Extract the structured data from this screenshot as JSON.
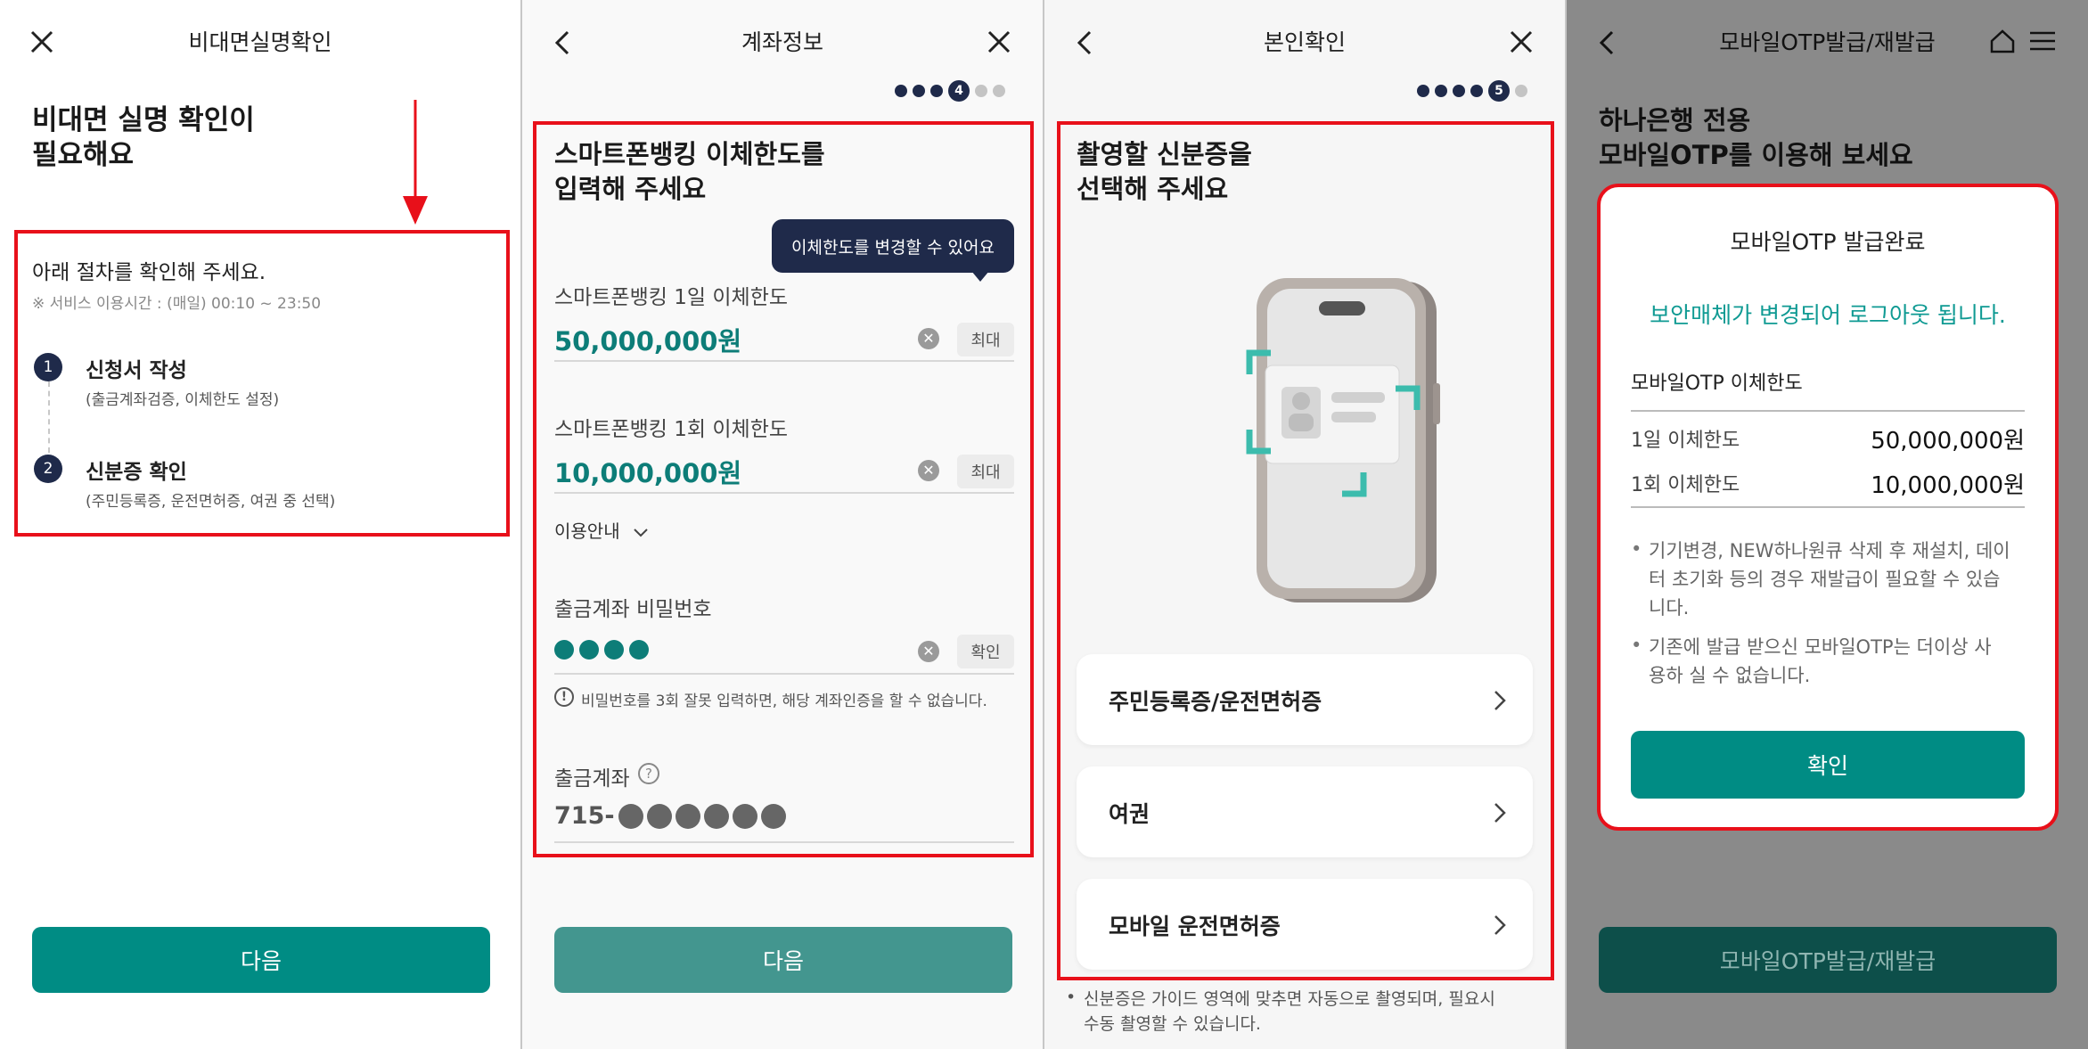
{
  "panel1": {
    "title": "비대면실명확인",
    "heading_line1": "비대면 실명 확인이",
    "heading_line2": "필요해요",
    "box_title": "아래 절차를 확인해 주세요.",
    "service_time": "※ 서비스 이용시간 : (매일) 00:10 ~ 23:50",
    "steps": [
      {
        "num": "1",
        "title": "신청서 작성",
        "desc": "(출금계좌검증, 이체한도 설정)"
      },
      {
        "num": "2",
        "title": "신분증 확인",
        "desc": "(주민등록증, 운전면허증, 여권 중 선택)"
      }
    ],
    "next_button": "다음"
  },
  "panel2": {
    "title": "계좌정보",
    "step_current": "4",
    "heading_line1": "스마트폰뱅킹 이체한도를",
    "heading_line2": "입력해 주세요",
    "tooltip": "이체한도를 변경할 수 있어요",
    "daily_label": "스마트폰뱅킹 1일 이체한도",
    "daily_value": "50,000,000원",
    "max_label": "최대",
    "once_label": "스마트폰뱅킹 1회 이체한도",
    "once_value": "10,000,000원",
    "guide_label": "이용안내",
    "password_label": "출금계좌 비밀번호",
    "confirm_chip": "확인",
    "password_warning": "비밀번호를 3회 잘못 입력하면, 해당 계좌인증을 할 수 없습니다.",
    "account_label": "출금계좌",
    "account_prefix": "715-",
    "next_button": "다음"
  },
  "panel3": {
    "title": "본인확인",
    "step_current": "5",
    "heading_line1": "촬영할 신분증을",
    "heading_line2": "선택해 주세요",
    "options": [
      {
        "label": "주민등록증/운전면허증"
      },
      {
        "label": "여권"
      },
      {
        "label": "모바일 운전면허증"
      }
    ],
    "note_line1": "신분증은 가이드 영역에 맞추면 자동으로 촬영되며, 필요시",
    "note_line2": "수동 촬영할 수 있습니다."
  },
  "panel4": {
    "title": "모바일OTP발급/재발급",
    "heading_line1": "하나은행 전용",
    "heading_line2": "모바일OTP를 이용해 보세요",
    "modal_title": "모바일OTP 발급완료",
    "modal_notice": "보안매체가 변경되어 로그아웃 됩니다.",
    "limit_title": "모바일OTP 이체한도",
    "rows": [
      {
        "label": "1일 이체한도",
        "value": "50,000,000원"
      },
      {
        "label": "1회 이체한도",
        "value": "10,000,000원"
      }
    ],
    "bullet1_l1": "기기변경, NEW하나원큐 삭제 후 재설치, 데이",
    "bullet1_l2": "터 초기화 등의 경우 재발급이 필요할 수 있습",
    "bullet1_l3": "니다.",
    "bullet2_l1": "기존에 발급 받으신 모바일OTP는 더이상 사",
    "bullet2_l2": "용하 실 수 없습니다.",
    "confirm_button": "확인",
    "bottom_button": "모바일OTP발급/재발급"
  },
  "colors": {
    "teal": "#008c84",
    "red_highlight": "#e8101a",
    "navy": "#1f2a4a"
  }
}
